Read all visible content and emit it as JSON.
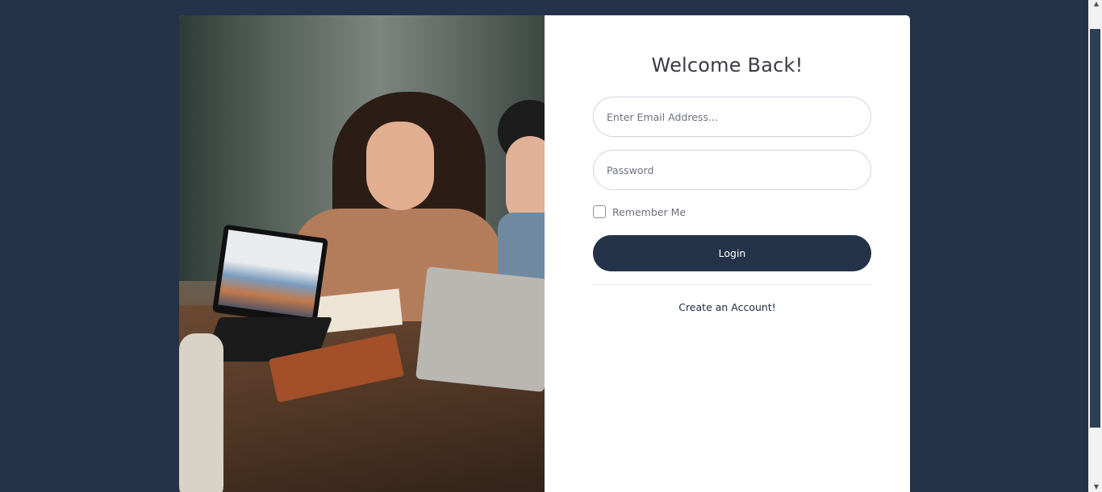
{
  "login": {
    "title": "Welcome Back!",
    "email_placeholder": "Enter Email Address...",
    "password_placeholder": "Password",
    "remember_label": "Remember Me",
    "login_label": "Login",
    "create_account_label": "Create an Account!"
  },
  "scrollbar": {
    "up_icon": "▲",
    "down_icon": "▼"
  },
  "colors": {
    "background": "#243349",
    "button": "#243349",
    "card": "#ffffff"
  }
}
